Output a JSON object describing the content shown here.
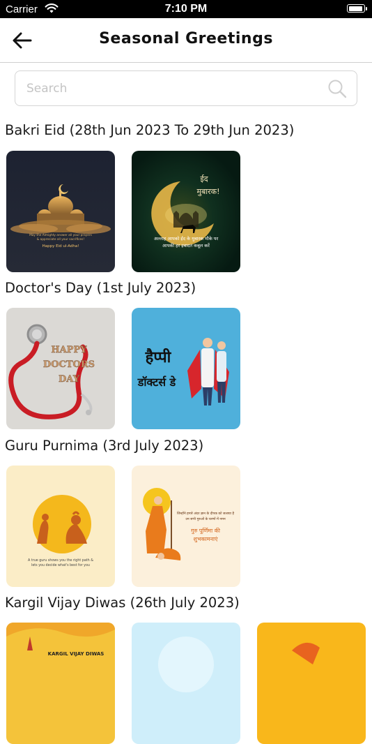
{
  "status_bar": {
    "carrier": "Carrier",
    "time": "7:10 PM"
  },
  "nav": {
    "title": "Seasonal Greetings"
  },
  "search": {
    "placeholder": "Search",
    "value": ""
  },
  "sections": [
    {
      "title": "Bakri Eid (28th Jun 2023 To 29th Jun 2023)",
      "cards": [
        {
          "lines": [
            "May the Almighty answer all your prayers",
            "& appreciate all your sacrifices!"
          ],
          "greeting": "Happy Eid ul-Adha!"
        },
        {
          "heading": [
            "ईद",
            "मुबारक!"
          ],
          "lines": [
            "अल्लाह आपको ईद के मुबारक मौके पर",
            "आपकी हर इबादत कबूल करें"
          ]
        }
      ]
    },
    {
      "title": "Doctor's Day (1st July 2023)",
      "cards": [
        {
          "lines": [
            "HAPPY",
            "DOCTORS",
            "DAY"
          ]
        },
        {
          "lines": [
            "हैप्पी",
            "डॉक्टर्स डे"
          ]
        }
      ]
    },
    {
      "title": "Guru Purnima (3rd July 2023)",
      "cards": [
        {
          "lines": [
            "A true guru shows you the right path &",
            "lets you decide what's best for you"
          ]
        },
        {
          "lines": [
            "जिन्होंने हमारे अंदर ज्ञान के दीपक को जलाया है",
            "उन सभी गुरुओं के चरणों में नमन"
          ],
          "greeting": [
            "गुरु पूर्णिमा की",
            "शुभकामनाएं"
          ]
        }
      ]
    },
    {
      "title": "Kargil Vijay Diwas (26th July 2023)",
      "cards": [
        {
          "lines": [
            "KARGIL VIJAY DIWAS"
          ]
        },
        {
          "lines": []
        },
        {
          "lines": []
        }
      ]
    }
  ]
}
